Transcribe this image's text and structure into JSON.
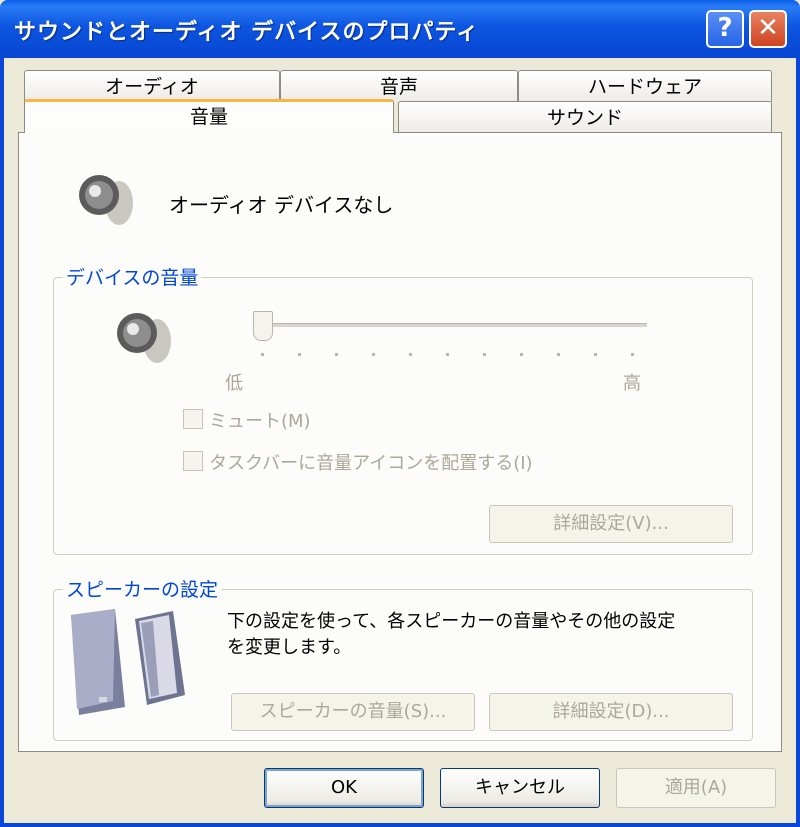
{
  "window": {
    "title": "サウンドとオーディオ デバイスのプロパティ",
    "help_label": "?",
    "close_label": "✕"
  },
  "tabs": {
    "row_back": [
      {
        "label": "オーディオ"
      },
      {
        "label": "音声"
      },
      {
        "label": "ハードウェア"
      }
    ],
    "row_front": [
      {
        "label": "音量",
        "active": true
      },
      {
        "label": "サウンド"
      }
    ]
  },
  "device": {
    "icon": "speaker-icon",
    "status": "オーディオ デバイスなし"
  },
  "device_volume": {
    "group_label": "デバイスの音量",
    "icon": "speaker-icon",
    "slider_level": 0,
    "low_label": "低",
    "high_label": "高",
    "mute_label": "ミュート(M)",
    "mute_checked": false,
    "taskbar_label": "タスクバーに音量アイコンを配置する(I)",
    "taskbar_checked": false,
    "advanced_button": "詳細設定(V)..."
  },
  "speaker_settings": {
    "group_label": "スピーカーの設定",
    "icon": "speakers-icon",
    "description_line1": "下の設定を使って、各スピーカーの音量やその他の設定",
    "description_line2": "を変更します。",
    "volume_button": "スピーカーの音量(S)...",
    "advanced_button": "詳細設定(D)..."
  },
  "footer": {
    "ok": "OK",
    "cancel": "キャンセル",
    "apply": "適用(A)"
  }
}
